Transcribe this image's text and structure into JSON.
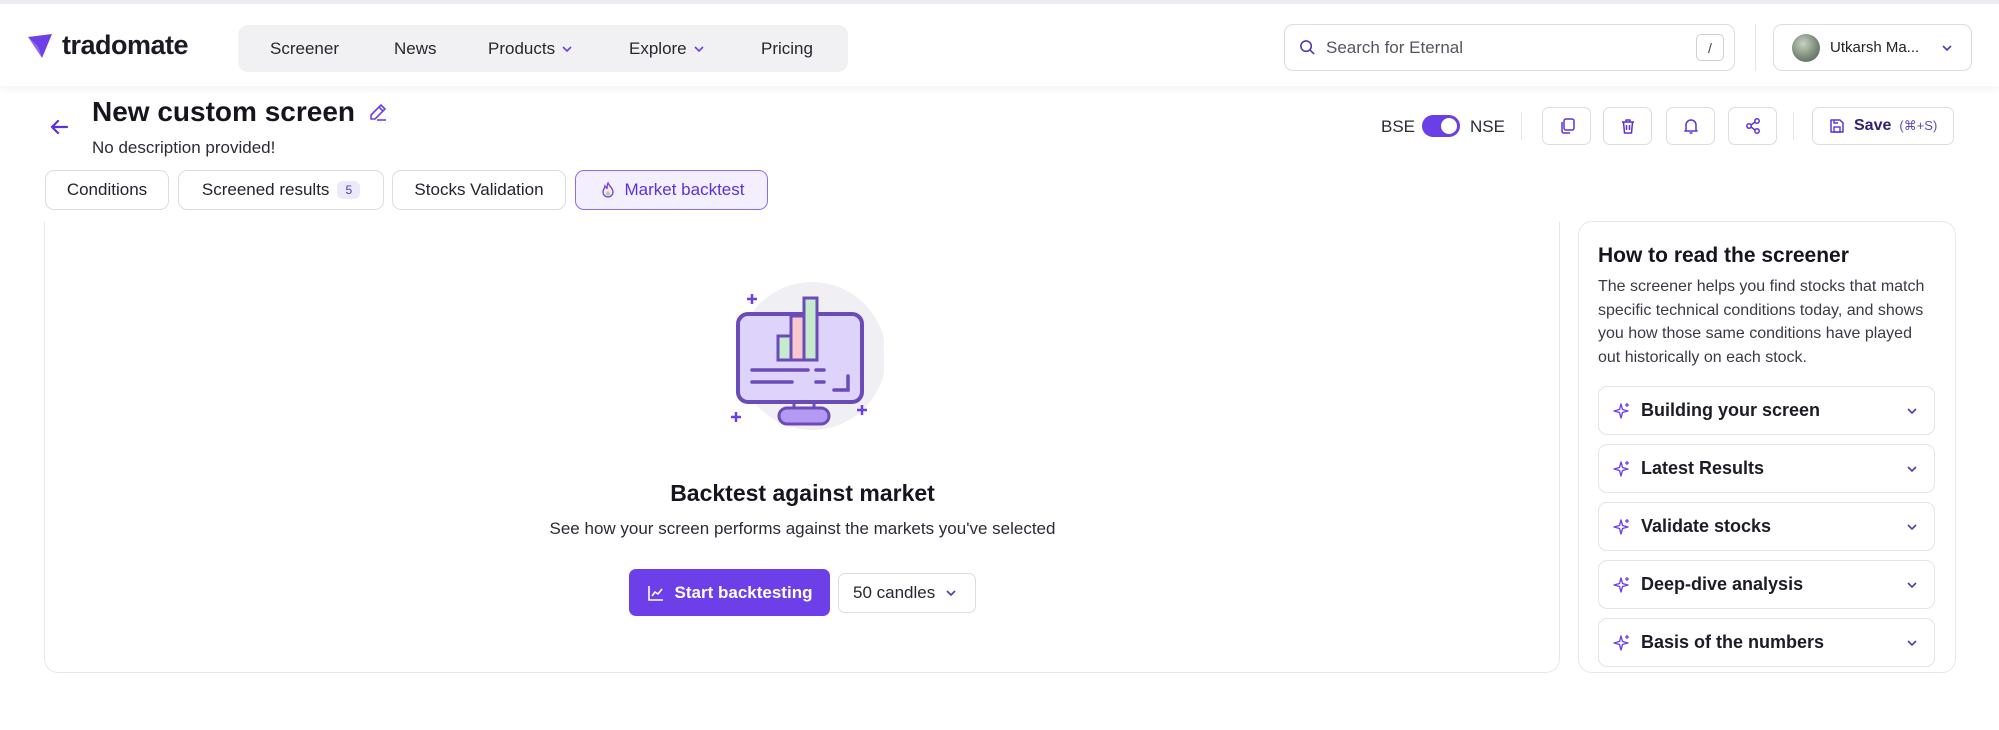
{
  "brand": {
    "name": "tradomate",
    "accent": "#6d3fe9"
  },
  "nav": {
    "items": [
      {
        "label": "Screener"
      },
      {
        "label": "News"
      },
      {
        "label": "Products",
        "has_dropdown": true
      },
      {
        "label": "Explore",
        "has_dropdown": true
      },
      {
        "label": "Pricing"
      }
    ]
  },
  "search": {
    "placeholder": "Search for Eternal",
    "shortcut": "/"
  },
  "user": {
    "name": "Utkarsh Ma..."
  },
  "header": {
    "title": "New custom screen",
    "description": "No description provided!",
    "exchange_left": "BSE",
    "exchange_right": "NSE",
    "exchange_toggle_on": true,
    "save_label": "Save",
    "save_shortcut": "(⌘+S)"
  },
  "tabs": [
    {
      "label": "Conditions"
    },
    {
      "label": "Screened results",
      "badge": "5"
    },
    {
      "label": "Stocks Validation"
    },
    {
      "label": "Market backtest",
      "active": true
    }
  ],
  "main": {
    "title": "Backtest against market",
    "subtitle": "See how your screen performs against the markets you've selected",
    "start_label": "Start backtesting",
    "candles_label": "50 candles"
  },
  "side": {
    "title": "How to read the screener",
    "body": "The screener helps you find stocks that match specific technical conditions today, and shows you how those same conditions have played out historically on each stock.",
    "sections": [
      {
        "label": "Building your screen"
      },
      {
        "label": "Latest Results"
      },
      {
        "label": "Validate stocks"
      },
      {
        "label": "Deep-dive analysis"
      },
      {
        "label": "Basis of the numbers"
      }
    ]
  }
}
